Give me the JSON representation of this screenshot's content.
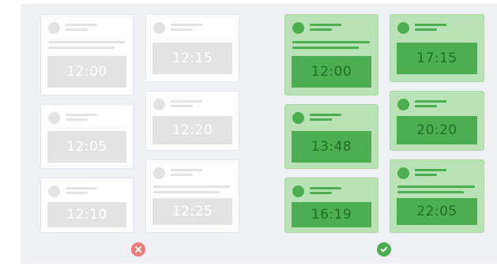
{
  "bad_example": {
    "status_icon": "cross-icon",
    "color": "#ec7b7b",
    "cards": [
      {
        "time": "12:00"
      },
      {
        "time": "12:15"
      },
      {
        "time": "12:05"
      },
      {
        "time": "12:20"
      },
      {
        "time": "12:10"
      },
      {
        "time": "12:25"
      }
    ]
  },
  "good_example": {
    "status_icon": "check-icon",
    "color": "#4cae51",
    "cards": [
      {
        "time": "12:00"
      },
      {
        "time": "17:15"
      },
      {
        "time": "13:48"
      },
      {
        "time": "20:20"
      },
      {
        "time": "16:19"
      },
      {
        "time": "22:05"
      }
    ]
  }
}
